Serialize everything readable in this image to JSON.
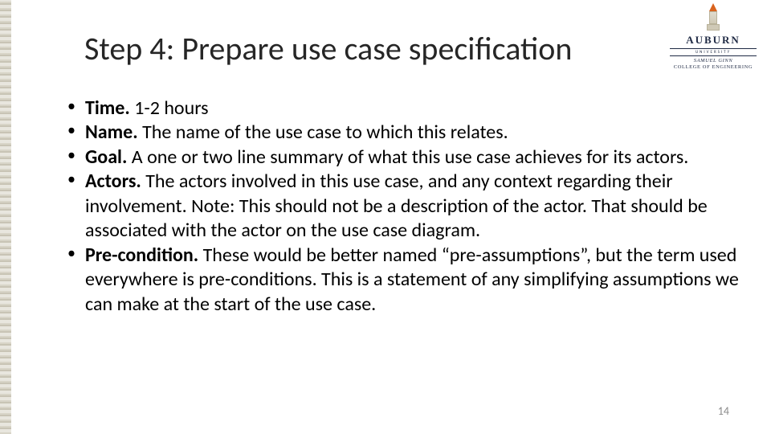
{
  "title": "Step 4: Prepare use case specification",
  "logo": {
    "word": "AUBURN",
    "sub": "UNIVERSITY",
    "college_line1": "SAMUEL GINN",
    "college_line2": "COLLEGE OF ENGINEERING"
  },
  "bullets": [
    {
      "label": "Time.",
      "text": " 1-2 hours"
    },
    {
      "label": "Name.",
      "text": " The name of the use case to which this relates."
    },
    {
      "label": "Goal.",
      "text": " A one or two line summary of what this use case achieves for its actors."
    },
    {
      "label": "Actors.",
      "text": " The actors involved in this use case, and any context regarding their involvement. Note: This should not be a description of the actor. That should be associated with the actor on the use case diagram."
    },
    {
      "label": "Pre-condition.",
      "text": " These would be better named “pre-assumptions”, but the term used everywhere is pre-conditions. This is a statement of any simplifying assumptions we can make at the start of the use case."
    }
  ],
  "page_number": "14"
}
